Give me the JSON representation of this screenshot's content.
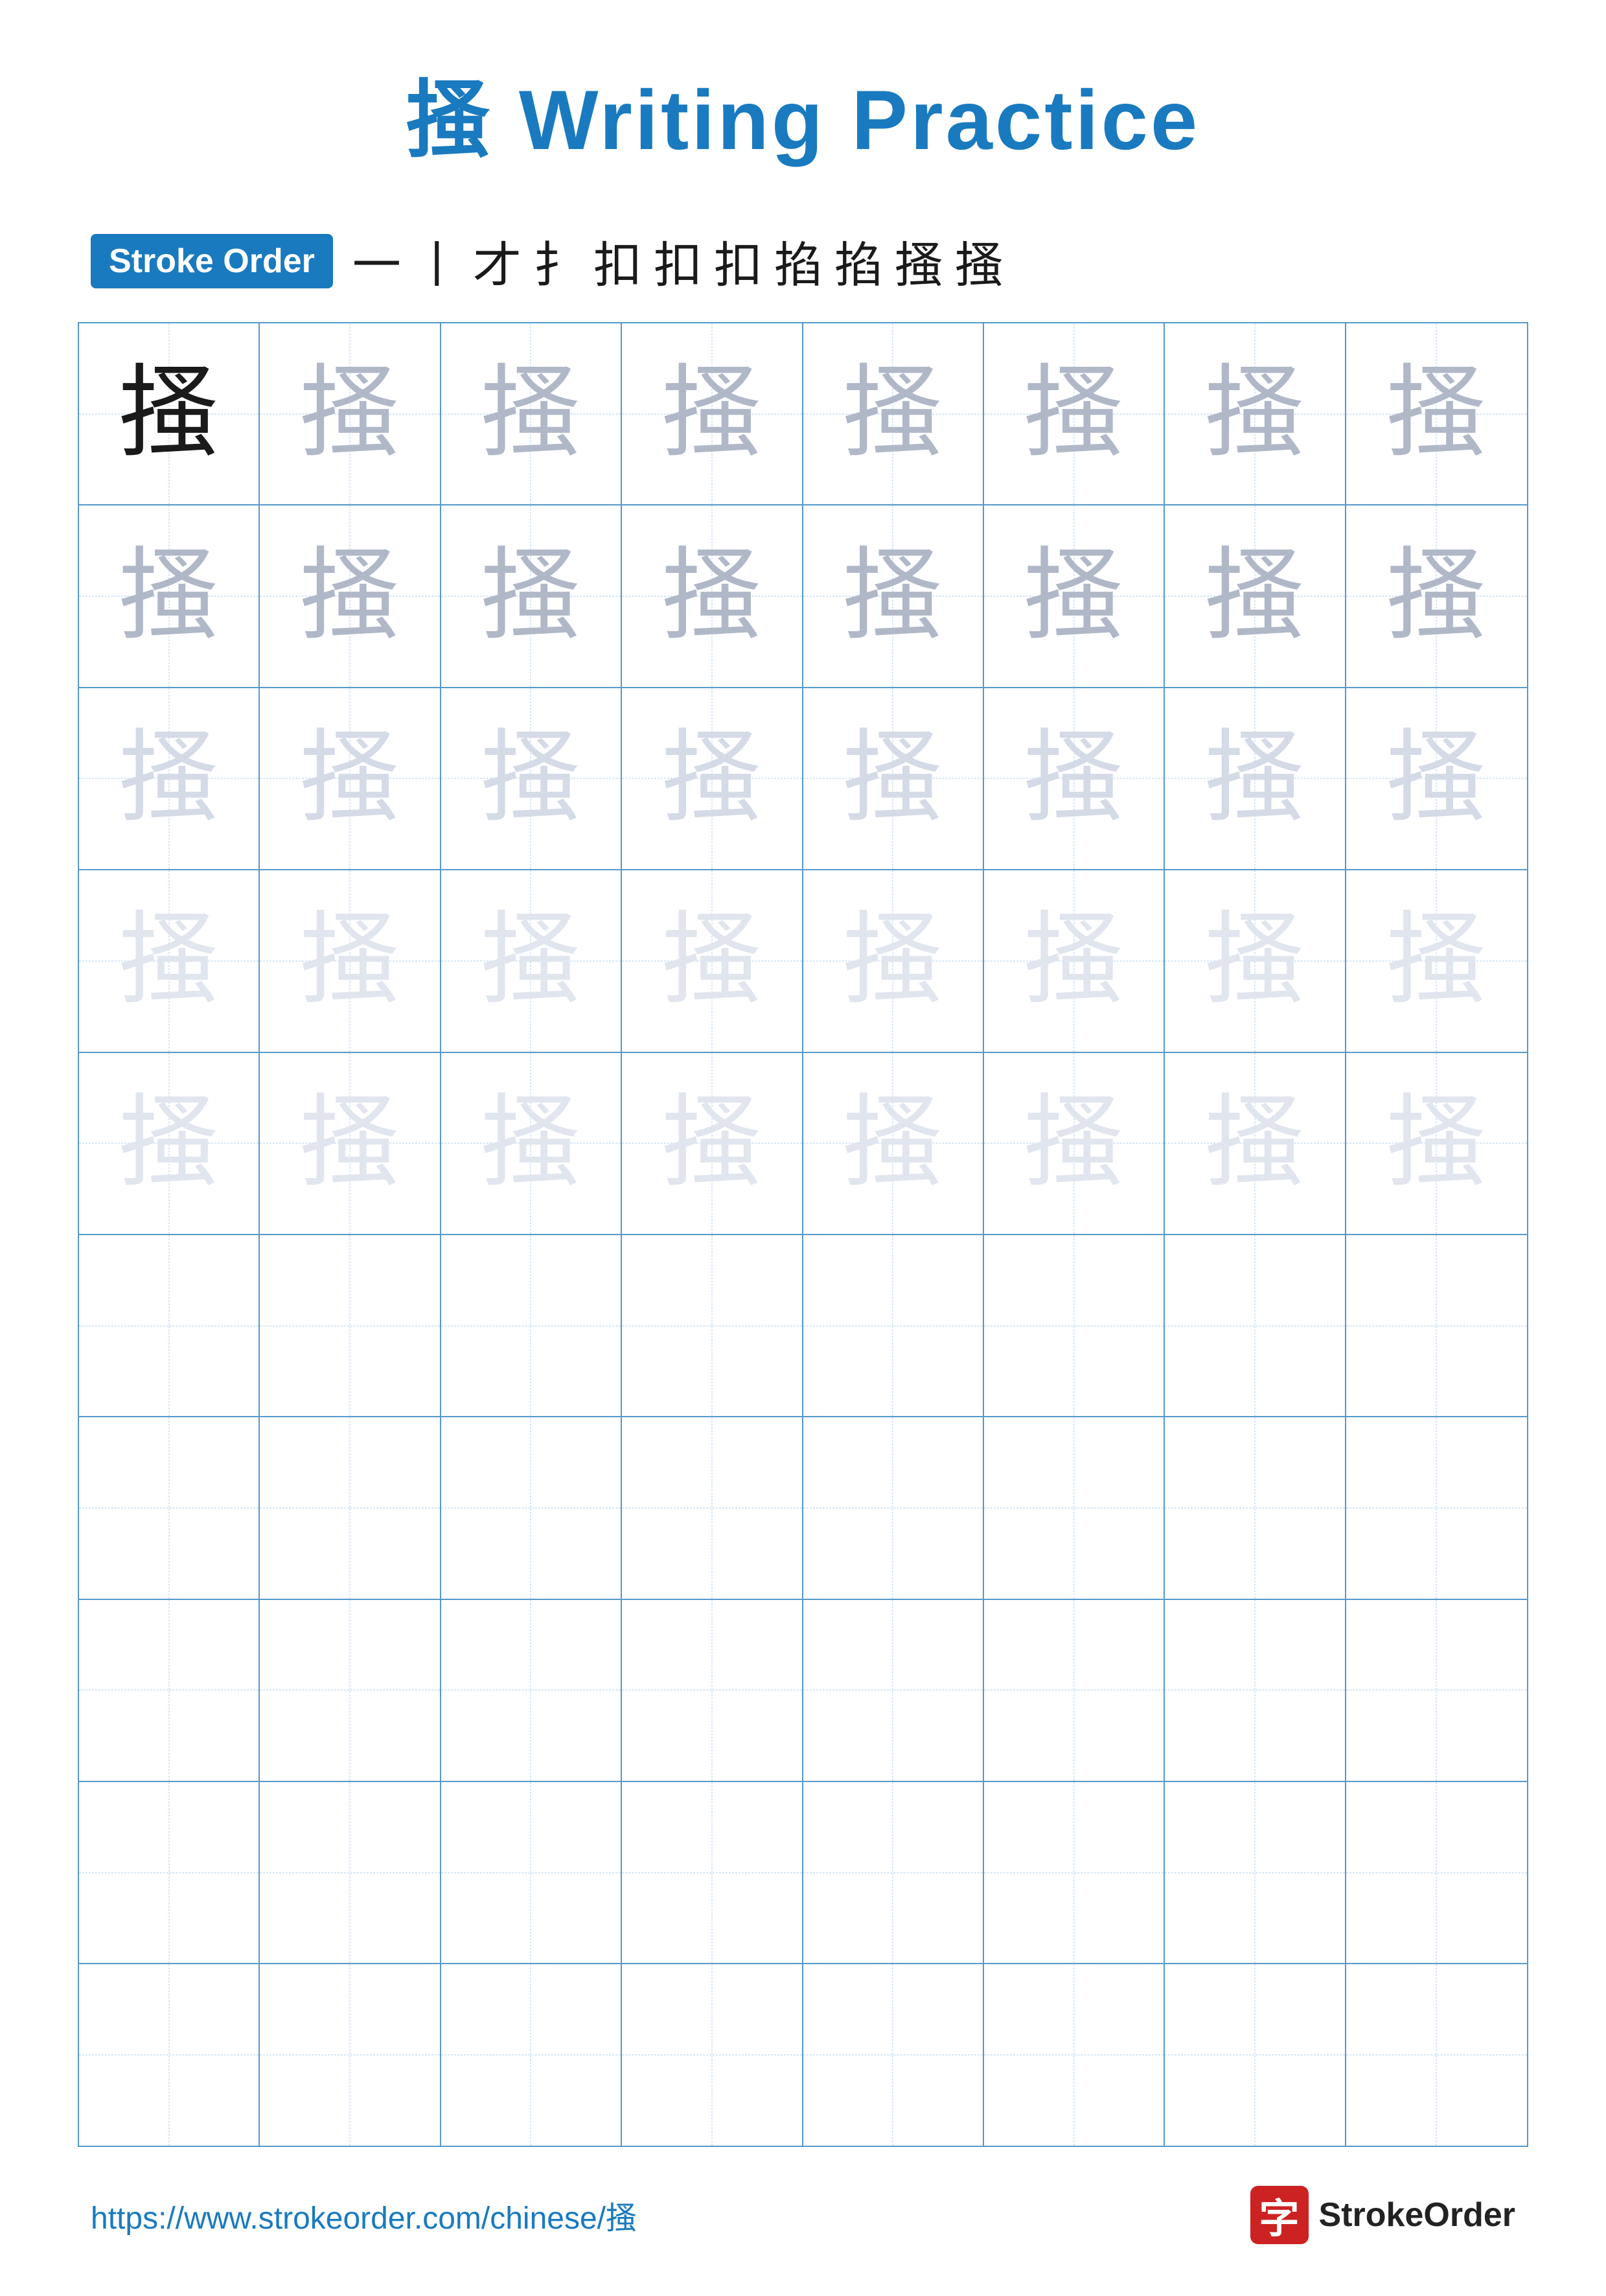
{
  "title": {
    "character": "搔",
    "label": "Writing Practice",
    "full": "搔 Writing Practice"
  },
  "stroke_order": {
    "badge_label": "Stroke Order",
    "strokes": [
      "一",
      "丨",
      "才",
      "扌",
      "扣",
      "扣",
      "扣",
      "掐",
      "掐",
      "搔",
      "搔"
    ]
  },
  "grid": {
    "character": "搔",
    "rows": [
      {
        "type": "dark",
        "label": "row-1"
      },
      {
        "type": "medium",
        "label": "row-2"
      },
      {
        "type": "light",
        "label": "row-3"
      },
      {
        "type": "very-light",
        "label": "row-4"
      },
      {
        "type": "very-light",
        "label": "row-5"
      },
      {
        "type": "empty",
        "label": "row-6"
      },
      {
        "type": "empty",
        "label": "row-7"
      },
      {
        "type": "empty",
        "label": "row-8"
      },
      {
        "type": "empty",
        "label": "row-9"
      },
      {
        "type": "empty",
        "label": "row-10"
      }
    ],
    "cols": 8
  },
  "footer": {
    "url": "https://www.strokeorder.com/chinese/搔",
    "brand_name": "StrokeOrder",
    "brand_char": "字"
  }
}
